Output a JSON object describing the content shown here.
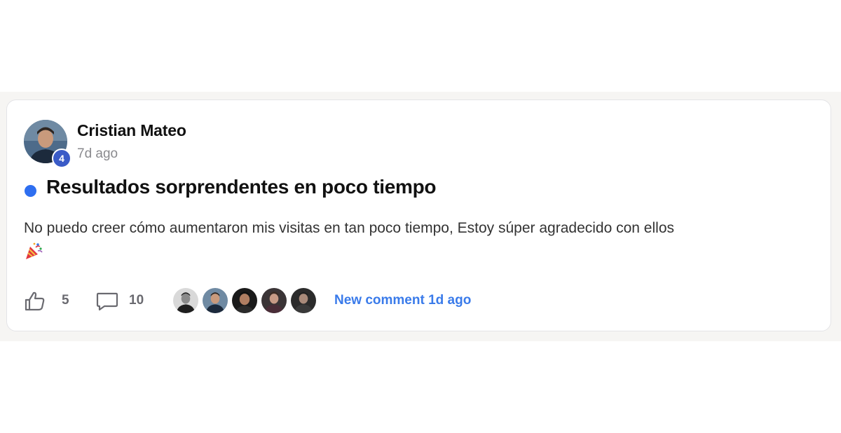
{
  "post": {
    "author": {
      "name": "Cristian Mateo",
      "level": "4"
    },
    "time": "7d ago",
    "title": "Resultados sorprendentes en poco tiempo",
    "body": "No puedo creer cómo aumentaron mis visitas en tan poco tiempo, Estoy súper agradecido con ellos",
    "body_emoji": "party-popper-icon",
    "unread": true,
    "colors": {
      "unread_dot": "#2e6ef0",
      "level_badge": "#3a5bc7",
      "link": "#3a7bea"
    }
  },
  "footer": {
    "likes": "5",
    "comments": "10",
    "like_icon": "thumbs-up-icon",
    "comment_icon": "comment-bubble-icon",
    "commenter_count": 5,
    "new_comment_label": "New comment 1d ago"
  }
}
